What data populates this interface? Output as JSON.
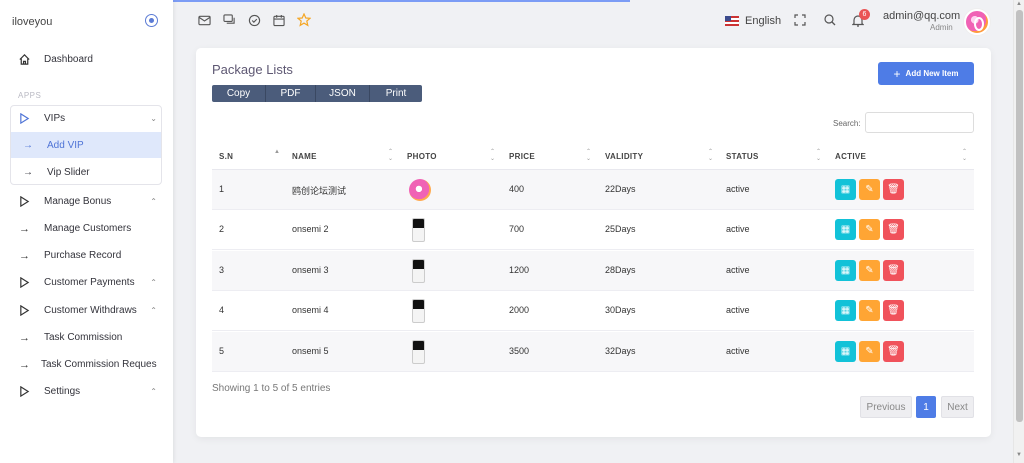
{
  "sidebar": {
    "brand": "iloveyou",
    "section_apps": "APPS",
    "items": [
      {
        "label": "Dashboard",
        "icon": "home-icon"
      },
      {
        "label": "VIPs",
        "icon": "triangle-right-icon"
      },
      {
        "label": "Manage Bonus",
        "icon": "triangle-right-icon"
      },
      {
        "label": "Manage Customers",
        "icon": "arrow-right-icon"
      },
      {
        "label": "Purchase Record",
        "icon": "arrow-right-icon"
      },
      {
        "label": "Customer Payments",
        "icon": "triangle-right-icon"
      },
      {
        "label": "Customer Withdraws",
        "icon": "triangle-right-icon"
      },
      {
        "label": "Task Commission",
        "icon": "arrow-right-icon"
      },
      {
        "label": "Task Commission Reques",
        "icon": "arrow-right-icon"
      },
      {
        "label": "Settings",
        "icon": "triangle-right-icon"
      }
    ],
    "vip_sub": [
      {
        "label": "Add VIP"
      },
      {
        "label": "Vip Slider"
      }
    ]
  },
  "topbar": {
    "language": "English",
    "notification_count": "6",
    "user_email": "admin@qq.com",
    "user_role": "Admin"
  },
  "card": {
    "title": "Package Lists",
    "add_button": "Add New Item",
    "export_buttons": [
      "Copy",
      "PDF",
      "JSON",
      "Print"
    ],
    "search_label": "Search:",
    "columns": [
      "S.N",
      "NAME",
      "PHOTO",
      "PRICE",
      "VALIDITY",
      "STATUS",
      "ACTIVE"
    ],
    "rows": [
      {
        "sn": "1",
        "name": "鸥创论坛测试",
        "price": "400",
        "validity": "22Days",
        "status": "active"
      },
      {
        "sn": "2",
        "name": "onsemi 2",
        "price": "700",
        "validity": "25Days",
        "status": "active"
      },
      {
        "sn": "3",
        "name": "onsemi 3",
        "price": "1200",
        "validity": "28Days",
        "status": "active"
      },
      {
        "sn": "4",
        "name": "onsemi 4",
        "price": "2000",
        "validity": "30Days",
        "status": "active"
      },
      {
        "sn": "5",
        "name": "onsemi 5",
        "price": "3500",
        "validity": "32Days",
        "status": "active"
      }
    ],
    "showing": "Showing 1 to 5 of 5 entries",
    "pagination": {
      "prev": "Previous",
      "current": "1",
      "next": "Next"
    }
  },
  "colors": {
    "accent": "#4e7ce6",
    "cal": "#12c2d8",
    "edit": "#ffa534",
    "delete": "#f0525b",
    "export": "#4b5c7b"
  }
}
